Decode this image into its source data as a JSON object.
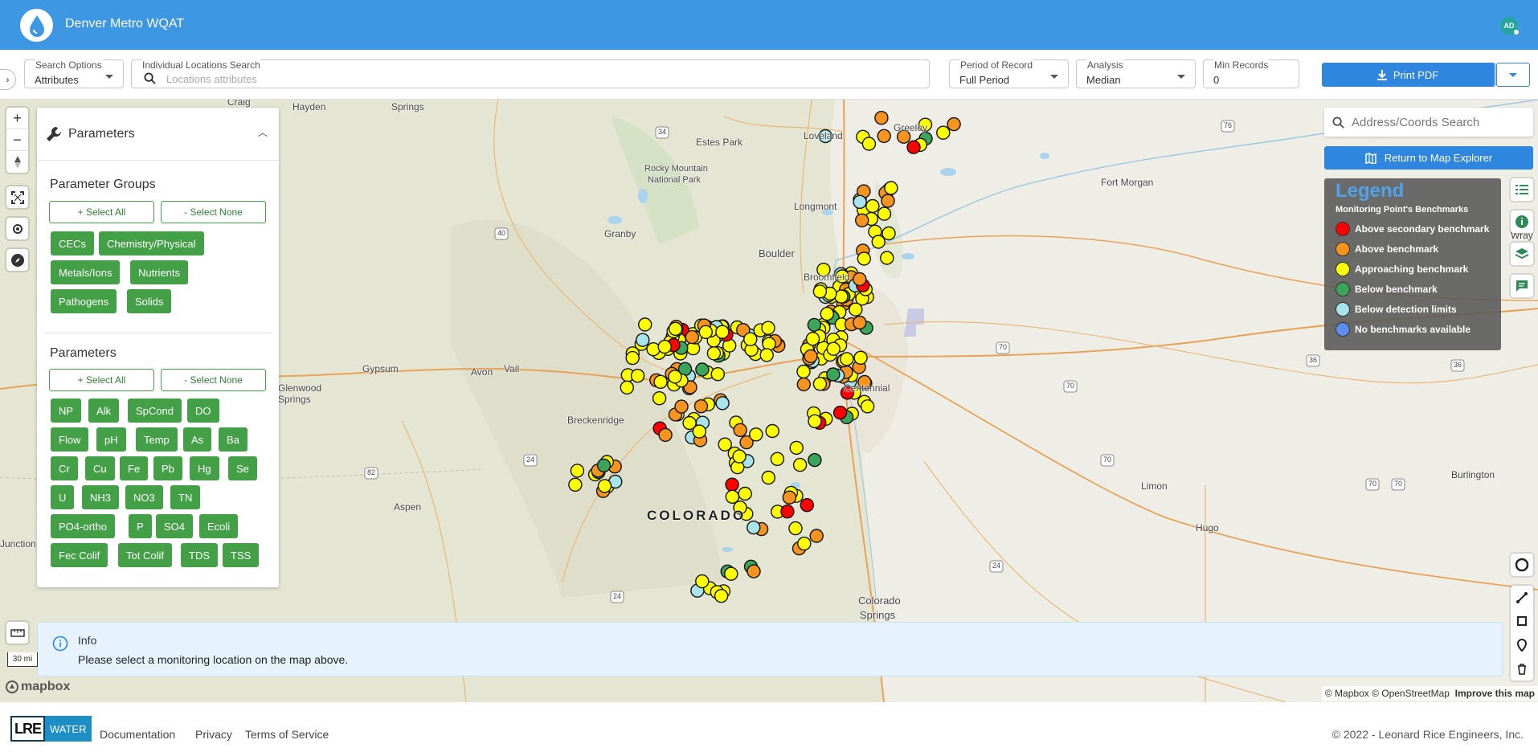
{
  "header": {
    "title": "Denver Metro WQAT",
    "avatar_initials": "AD"
  },
  "toolbar": {
    "search_options": {
      "label": "Search Options",
      "value": "Attributes"
    },
    "locations_search": {
      "label": "Individual Locations Search",
      "placeholder": "Locations attributes"
    },
    "period": {
      "label": "Period of Record",
      "value": "Full Period"
    },
    "analysis": {
      "label": "Analysis",
      "value": "Median"
    },
    "min_records": {
      "label": "Min Records",
      "value": "0"
    },
    "print_label": "Print PDF"
  },
  "params_panel": {
    "title": "Parameters",
    "groups_title": "Parameter Groups",
    "params_title": "Parameters",
    "select_all": "+ Select All",
    "select_none": "- Select None",
    "groups": [
      "CECs",
      "Chemistry/Physical",
      "Metals/Ions",
      "Nutrients",
      "Pathogens",
      "Solids"
    ],
    "params": [
      "NP",
      "Alk",
      "SpCond",
      "DO",
      "Flow",
      "pH",
      "Temp",
      "As",
      "Ba",
      "Cr",
      "Cu",
      "Fe",
      "Pb",
      "Hg",
      "Se",
      "U",
      "NH3",
      "NO3",
      "TN",
      "PO4-ortho",
      "P",
      "SO4",
      "Ecoli",
      "Fec Colif",
      "Tot Colif",
      "TDS",
      "TSS"
    ]
  },
  "map": {
    "address_placeholder": "Address/Coords Search",
    "return_label": "Return to Map Explorer",
    "scale": "30 mi",
    "mapbox": "mapbox",
    "attribution": "© Mapbox © OpenStreetMap",
    "improve": "Improve this map",
    "places": [
      "Hayden",
      "Craig",
      "Springs",
      "Loveland",
      "Greeley",
      "Estes Park",
      "Rocky Mountain",
      "National Park",
      "Fort Morgan",
      "Longmont",
      "Granby",
      "Boulder",
      "Broomfield",
      "Gypsum",
      "Avon",
      "Vail",
      "Breckenridge",
      "Centennial",
      "Glenwood",
      "Springs",
      "Aspen",
      "COLORADO",
      "Limon",
      "Hugo",
      "Burlington",
      "Colorado",
      "Springs",
      "Junction",
      "Wray"
    ],
    "roads": [
      "34",
      "40",
      "70",
      "70",
      "70",
      "70",
      "70",
      "36",
      "36",
      "24",
      "24",
      "24",
      "82",
      "76"
    ]
  },
  "legend": {
    "title": "Legend",
    "subtitle": "Monitoring Point's Benchmarks",
    "items": [
      {
        "label": "Above secondary benchmark",
        "color": "#ff0000"
      },
      {
        "label": "Above benchmark",
        "color": "#f7941d"
      },
      {
        "label": "Approaching benchmark",
        "color": "#ffff00"
      },
      {
        "label": "Below benchmark",
        "color": "#3aa55b"
      },
      {
        "label": "Below detection limits",
        "color": "#a9e4ec"
      },
      {
        "label": "No benchmarks available",
        "color": "#5b8def"
      }
    ]
  },
  "info": {
    "title": "Info",
    "message": "Please select a monitoring location on the map above."
  },
  "footer": {
    "logo_a": "LRE",
    "logo_b": "WATER",
    "links": [
      "Documentation",
      "Privacy",
      "Terms of Service"
    ],
    "copyright": "© 2022 - Leonard Rice Engineers, Inc."
  }
}
